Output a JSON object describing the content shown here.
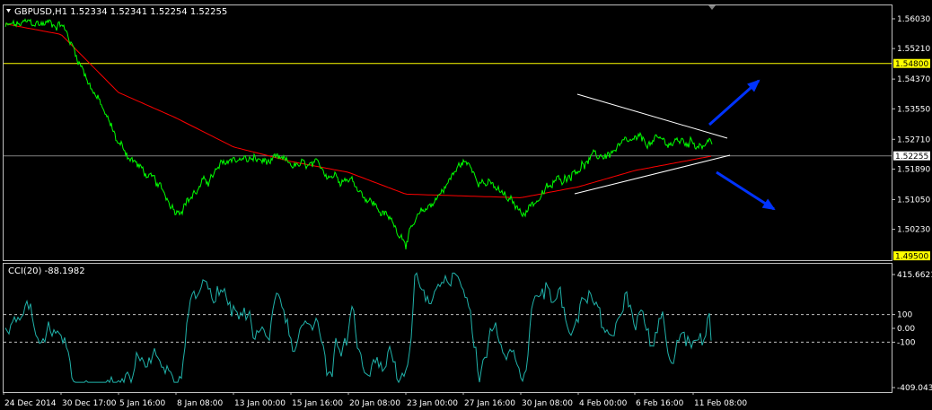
{
  "colors": {
    "background": "#000000",
    "frame": "#c0c0c0",
    "price": "#00ff00",
    "ma": "#ff0000",
    "cci": "#20b2aa",
    "yellow_level": "#ffff00",
    "current_price": "#808080",
    "trend_line": "#ffffff",
    "arrow": "#0033ff",
    "text": "#ffffff",
    "label_box": "#ffff00",
    "label_text": "#000000",
    "current_label_box": "#ffffff"
  },
  "main": {
    "title": "GBPUSD,H1  1.52334 1.52341 1.52254 1.52255",
    "y_ticks": [
      "1.56030",
      "1.55210",
      "1.54370",
      "1.53550",
      "1.52710",
      "1.51890",
      "1.51050",
      "1.50230"
    ],
    "horizontal_levels": [
      {
        "label": "1.54800",
        "value": 1.548
      },
      {
        "label": "1.49500",
        "value": 1.495
      }
    ],
    "current_price_label": "1.52255"
  },
  "indicator": {
    "title": "CCI(20) -88.1982",
    "y_ticks": [
      "415.6621",
      "100",
      "0.00",
      "-100",
      "-409.0438"
    ]
  },
  "x_ticks": [
    "24 Dec 2014",
    "30 Dec 17:00",
    "5 Jan 16:00",
    "8 Jan 08:00",
    "13 Jan 00:00",
    "15 Jan 16:00",
    "20 Jan 08:00",
    "23 Jan 00:00",
    "27 Jan 16:00",
    "30 Jan 08:00",
    "4 Feb 00:00",
    "6 Feb 16:00",
    "11 Feb 08:00"
  ],
  "chart_data": [
    {
      "type": "line",
      "symbol": "GBPUSD",
      "timeframe": "H1",
      "ohlc_last": {
        "open": 1.52334,
        "high": 1.52341,
        "low": 1.52254,
        "close": 1.52255
      },
      "x": [
        "24 Dec 2014",
        "30 Dec 17:00",
        "5 Jan 16:00",
        "8 Jan 08:00",
        "13 Jan 00:00",
        "15 Jan 16:00",
        "20 Jan 08:00",
        "23 Jan 00:00",
        "27 Jan 16:00",
        "30 Jan 08:00",
        "4 Feb 00:00",
        "6 Feb 16:00",
        "11 Feb 08:00"
      ],
      "ylim": [
        1.4938,
        1.564
      ],
      "series": [
        {
          "values": [
            1.558,
            1.5595,
            1.526,
            1.508,
            1.522,
            1.52,
            1.517,
            1.5,
            1.521,
            1.507,
            1.52,
            1.526,
            1.5265
          ]
        },
        {
          "values": [
            1.559,
            1.556,
            1.54,
            1.533,
            1.525,
            1.521,
            1.518,
            1.512,
            1.5115,
            1.511,
            1.514,
            1.5185,
            1.5225
          ]
        }
      ],
      "levels": [
        1.548,
        1.495,
        1.52255
      ]
    },
    {
      "type": "line",
      "indicator": "CCI",
      "period": 20,
      "last_value": -88.1982,
      "ylim": [
        -409.0438,
        415.6621
      ],
      "reference_levels": [
        100,
        0,
        -100
      ]
    }
  ]
}
